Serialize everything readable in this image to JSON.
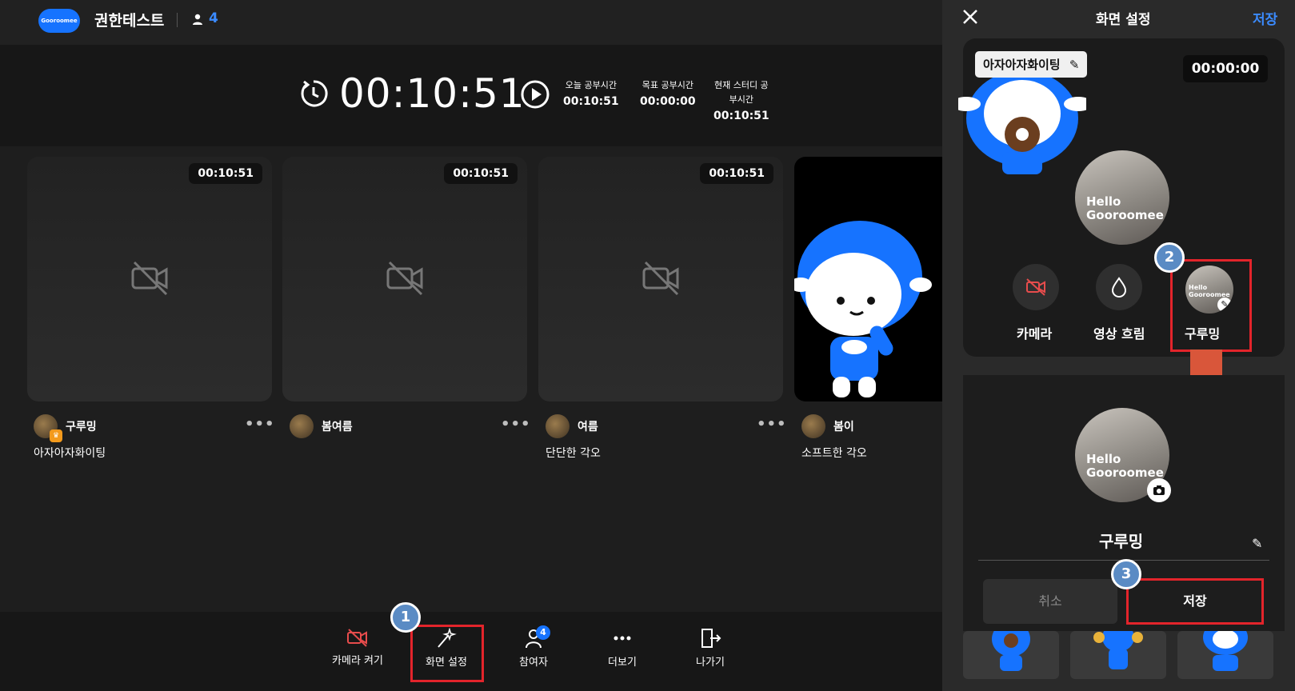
{
  "header": {
    "logo_text": "Gooroomee",
    "room_title": "권한테스트",
    "participant_count": "4"
  },
  "timer": {
    "main": "00:10:51",
    "stats": [
      {
        "label": "오늘 공부시간",
        "value": "00:10:51"
      },
      {
        "label": "목표 공부시간",
        "value": "00:00:00"
      },
      {
        "label": "현재 스터디 공부시간",
        "label_line1": "현재 스터디 공",
        "label_line2": "부시간",
        "value": "00:10:51"
      }
    ]
  },
  "members": [
    {
      "name": "구루밍",
      "time": "00:10:51",
      "resolution": "아자아자화이팅",
      "is_host": true
    },
    {
      "name": "봄여름",
      "time": "00:10:51",
      "resolution": ""
    },
    {
      "name": "여름",
      "time": "00:10:51",
      "resolution": "단단한 각오"
    },
    {
      "name": "봄이",
      "time": "",
      "resolution": "소프트한 각오"
    }
  ],
  "bottom_toolbar": {
    "camera_on": "카메라 켜기",
    "screen_settings": "화면 설정",
    "participants": "참여자",
    "participants_badge": "4",
    "more": "더보기",
    "leave": "나가기"
  },
  "panel": {
    "title": "화면 설정",
    "save_top": "저장",
    "preview_label": "아자아자화이팅",
    "preview_timer": "00:00:00",
    "hello_line1": "Hello",
    "hello_line2": "Gooroomee",
    "options": [
      {
        "label": "카메라"
      },
      {
        "label": "영상 흐림"
      },
      {
        "label": "구루밍"
      }
    ],
    "profile_name": "구루밍",
    "cancel": "취소",
    "save": "저장"
  },
  "steps": [
    "1",
    "2",
    "3"
  ],
  "colors": {
    "accent_blue": "#1673ff",
    "annotation_red": "#e3242b",
    "step_badge": "#5a8bc4",
    "arrow": "#d9563a",
    "camera_off_red": "#e74c4c"
  }
}
